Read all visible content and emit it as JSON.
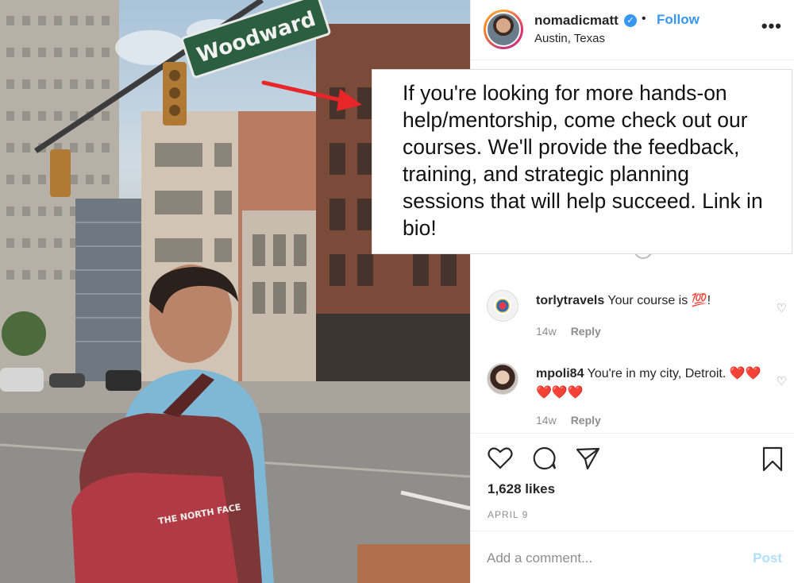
{
  "photo": {
    "street_sign": "Woodward",
    "backpack_brand": "THE NORTH FACE"
  },
  "post": {
    "username": "nomadicmatt",
    "verified_glyph": "✓",
    "separator": "•",
    "follow_label": "Follow",
    "location": "Austin, Texas",
    "more_glyph": "•••"
  },
  "callout": {
    "text": "If you're looking for more hands-on help/mentorship, come check out our courses. We'll provide the feedback, training, and strategic planning sessions that will help succeed. Link in bio!"
  },
  "comments": [
    {
      "username": "torlytravels",
      "text": "Your course is 💯!",
      "age": "14w",
      "reply_label": "Reply"
    },
    {
      "username": "mpoli84",
      "text": "You're in my city, Detroit. ❤️❤️❤️❤️❤️",
      "age": "14w",
      "reply_label": "Reply"
    }
  ],
  "actions": {
    "icons": [
      "heart-icon",
      "comment-icon",
      "share-icon",
      "bookmark-icon"
    ],
    "likes": "1,628 likes",
    "date": "APRIL 9"
  },
  "composer": {
    "placeholder": "Add a comment...",
    "post_label": "Post"
  },
  "colors": {
    "accent": "#3897f0",
    "arrow": "#e8262a",
    "post_disabled": "#b2dffc"
  }
}
